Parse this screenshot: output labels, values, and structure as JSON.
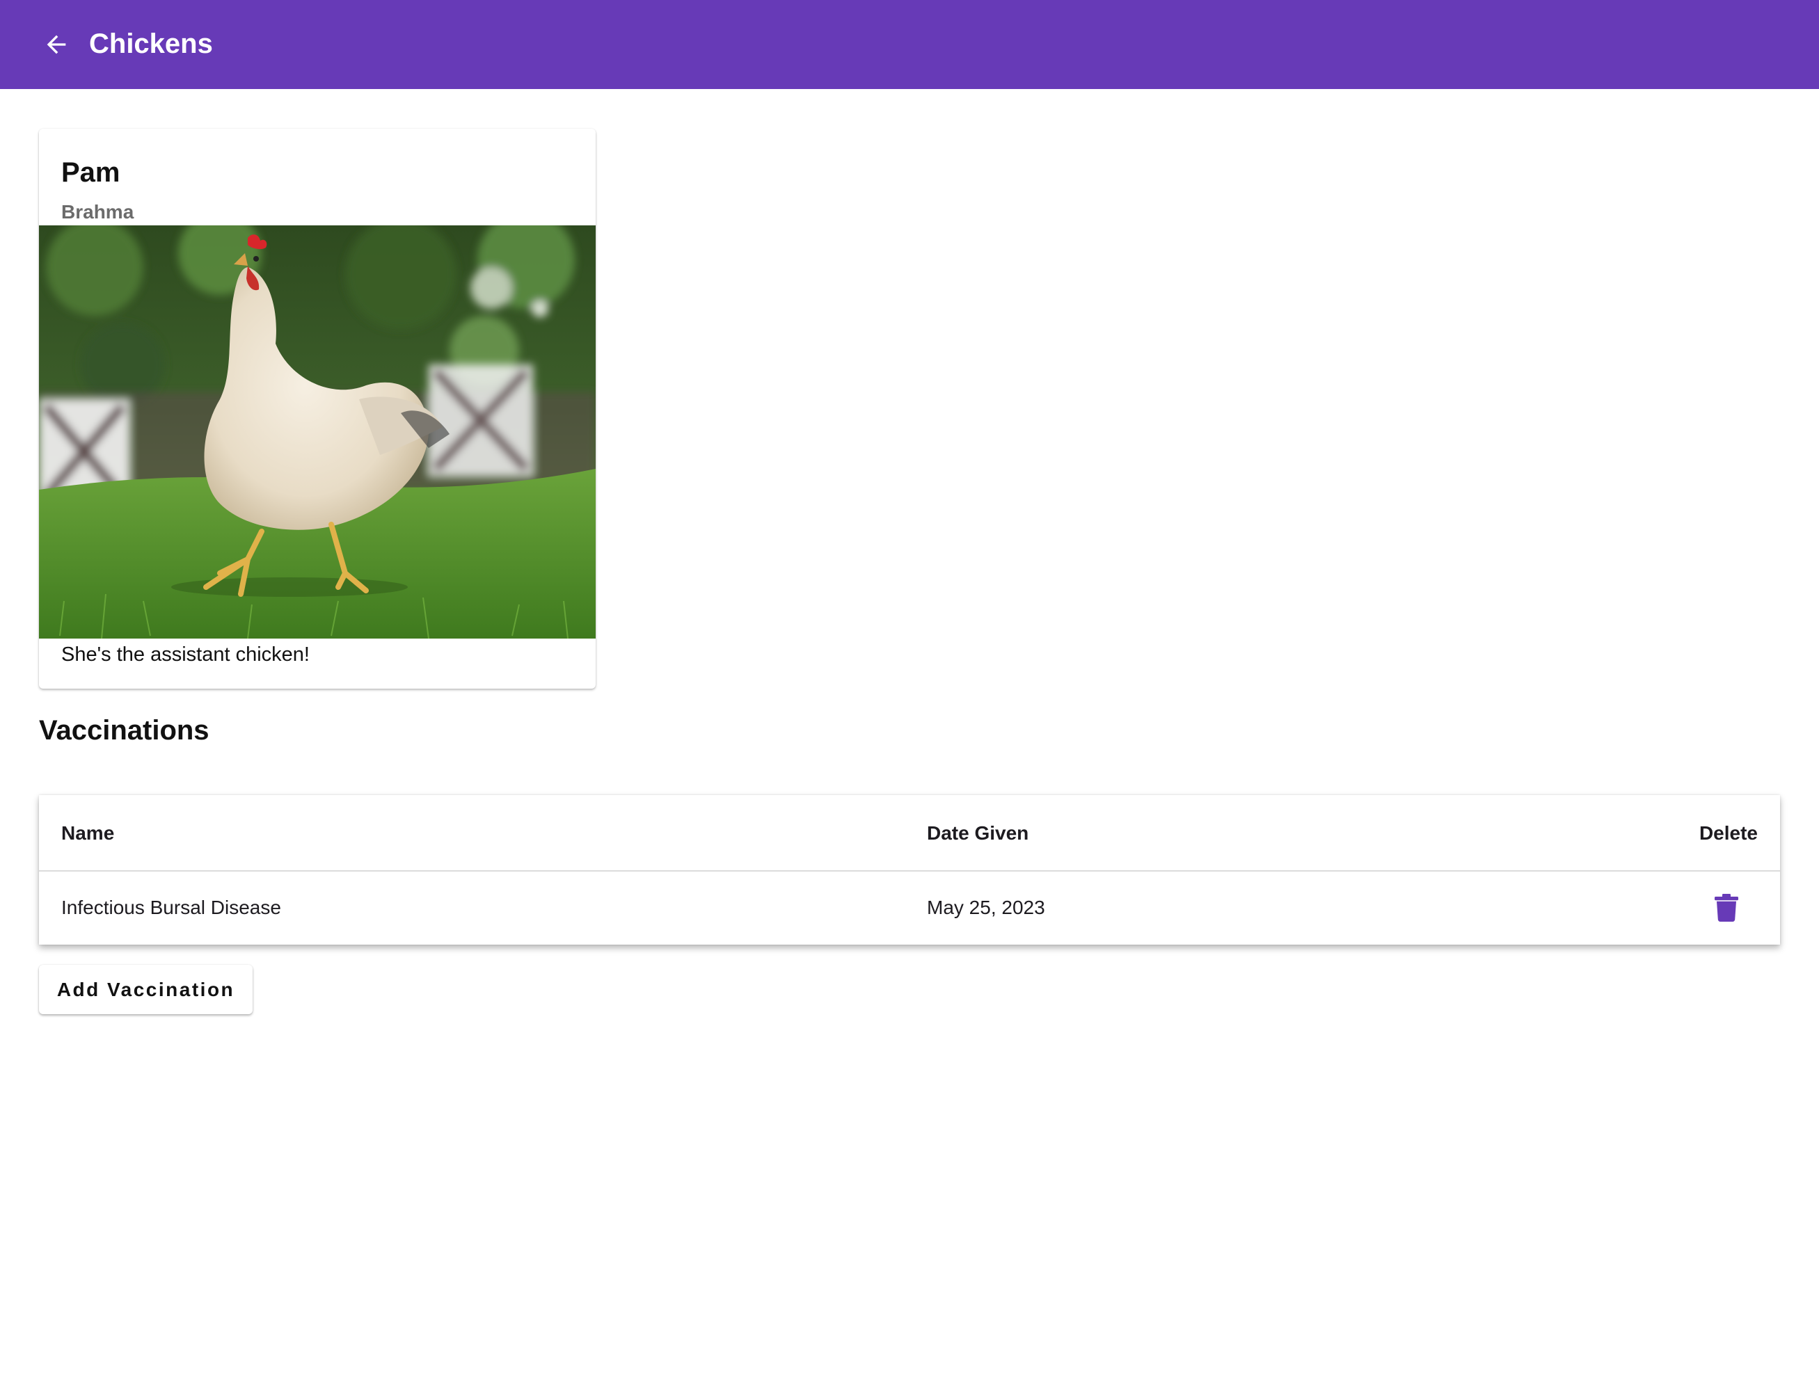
{
  "appbar": {
    "title": "Chickens",
    "back_icon": "arrow-left-icon",
    "color": "#673ab7"
  },
  "chicken": {
    "name": "Pam",
    "breed": "Brahma",
    "description": "She's the assistant chicken!"
  },
  "vaccinations": {
    "title": "Vaccinations",
    "columns": [
      "Name",
      "Date Given",
      "Delete"
    ],
    "rows": [
      {
        "name": "Infectious Bursal Disease",
        "date_given": "May 25, 2023",
        "delete_icon": "trash-icon"
      }
    ],
    "add_label": "Add Vaccination",
    "accent": "#673ab7"
  }
}
